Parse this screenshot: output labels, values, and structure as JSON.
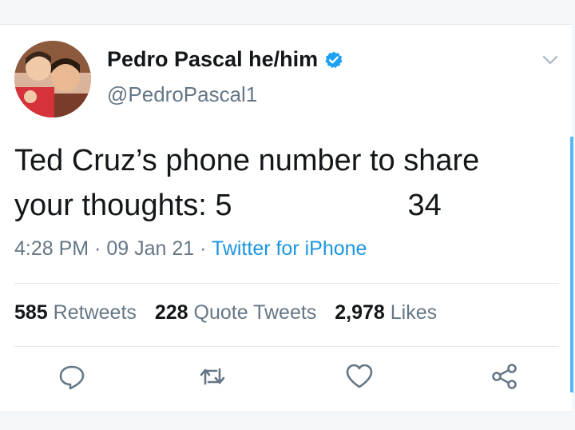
{
  "tweet": {
    "author": {
      "display_name": "Pedro Pascal he/him",
      "handle": "@PedroPascal1",
      "verified": true
    },
    "text": {
      "line1": "Ted Cruz’s phone number to share",
      "line2_start": "your thoughts: 5",
      "line2_end": "34"
    },
    "meta": {
      "time": "4:28 PM",
      "date": "09 Jan 21",
      "source": "Twitter for iPhone",
      "separator": " · "
    },
    "stats": {
      "retweets_count": "585",
      "retweets_label": "Retweets",
      "quotes_count": "228",
      "quotes_label": "Quote Tweets",
      "likes_count": "2,978",
      "likes_label": "Likes"
    }
  },
  "colors": {
    "accent": "#1da1f2",
    "link": "#1b95e0",
    "text": "#14171a",
    "muted": "#657786",
    "divider": "#e1e8ed"
  },
  "icons": {
    "verified": "verified-badge-icon",
    "menu": "chevron-down-icon",
    "reply": "reply-icon",
    "retweet": "retweet-icon",
    "like": "heart-icon",
    "share": "share-icon"
  }
}
